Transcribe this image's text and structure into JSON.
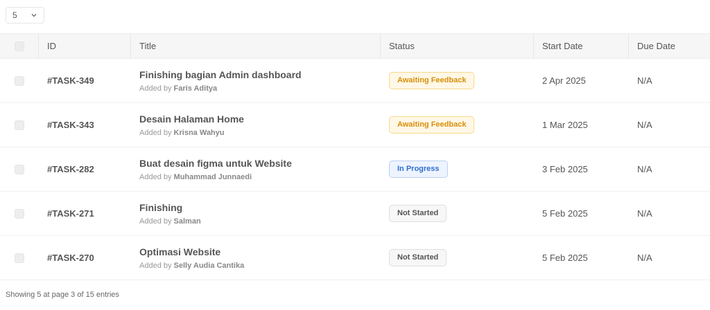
{
  "page_size": {
    "value": "5"
  },
  "columns": {
    "id": "ID",
    "title": "Title",
    "status": "Status",
    "start_date": "Start Date",
    "due_date": "Due Date"
  },
  "added_by_prefix": "Added by",
  "status_styles": {
    "Awaiting Feedback": {
      "bg": "#fff8e6",
      "border": "#f7d98b",
      "color": "#d98e0b"
    },
    "In Progress": {
      "bg": "#eef4ff",
      "border": "#b8cff3",
      "color": "#2f6fd0"
    },
    "Not Started": {
      "bg": "#f7f7f7",
      "border": "#dedede",
      "color": "#555555"
    }
  },
  "rows": [
    {
      "id": "#TASK-349",
      "title": "Finishing bagian Admin dashboard",
      "added_by": "Faris Aditya",
      "status": "Awaiting Feedback",
      "start_date": "2 Apr 2025",
      "due_date": "N/A"
    },
    {
      "id": "#TASK-343",
      "title": "Desain Halaman Home",
      "added_by": "Krisna Wahyu",
      "status": "Awaiting Feedback",
      "start_date": "1 Mar 2025",
      "due_date": "N/A"
    },
    {
      "id": "#TASK-282",
      "title": "Buat desain figma untuk Website",
      "added_by": "Muhammad Junnaedi",
      "status": "In Progress",
      "start_date": "3 Feb 2025",
      "due_date": "N/A"
    },
    {
      "id": "#TASK-271",
      "title": "Finishing",
      "added_by": "Salman",
      "status": "Not Started",
      "start_date": "5 Feb 2025",
      "due_date": "N/A"
    },
    {
      "id": "#TASK-270",
      "title": "Optimasi Website",
      "added_by": "Selly Audia Cantika",
      "status": "Not Started",
      "start_date": "5 Feb 2025",
      "due_date": "N/A"
    }
  ],
  "footer": {
    "text": "Showing 5 at page 3 of 15 entries"
  }
}
